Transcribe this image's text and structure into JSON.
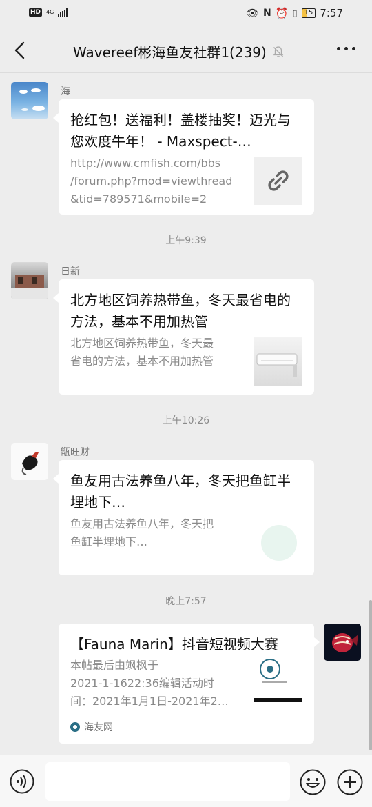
{
  "status_bar": {
    "hd_label": "HD",
    "network": "4G",
    "time": "7:57",
    "battery": "15"
  },
  "header": {
    "title": "Wavereef彬海鱼友社群1(239)"
  },
  "messages": [
    {
      "sender": "海",
      "title": "抢红包！送福利！盖楼抽奖！迈光与您欢度牛年！ - Maxspect-…",
      "desc_lines": [
        "http://www.cmfish.com/bbs",
        "/forum.php?mod=viewthread",
        "&tid=789571&mobile=2"
      ]
    },
    {
      "time": "上午9:39"
    },
    {
      "sender": "日新",
      "title": "北方地区饲养热带鱼，冬天最省电的方法，基本不用加热管",
      "desc_lines": [
        "北方地区饲养热带鱼，冬天最",
        "省电的方法，基本不用加热管"
      ]
    },
    {
      "time": "上午10:26"
    },
    {
      "sender": "甑旺财",
      "title": "鱼友用古法养鱼八年，冬天把鱼缸半埋地下…",
      "desc_lines": [
        "鱼友用古法养鱼八年，冬天把",
        "鱼缸半埋地下…"
      ]
    },
    {
      "time": "晚上7:57"
    },
    {
      "title": "【Fauna Marin】抖音短视频大赛",
      "desc_lines": [
        "本帖最后由飒枫于",
        "2021-1-1622:36编辑活动时",
        "间：2021年1月1日-2021年2…"
      ],
      "source": "海友网"
    }
  ],
  "input": {
    "placeholder": ""
  },
  "colors": {
    "background": "#ededed",
    "card": "#ffffff",
    "muted_text": "#8a8a8a"
  }
}
